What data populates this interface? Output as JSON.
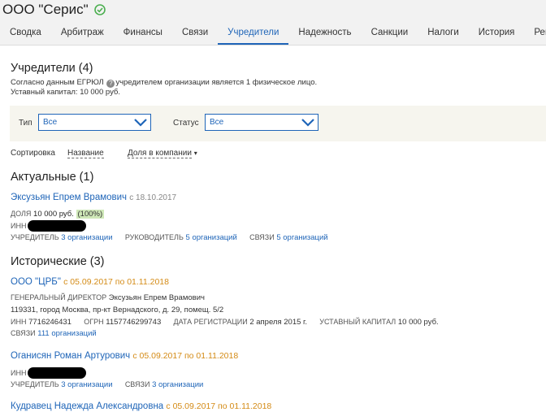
{
  "header": {
    "company_name": "ООО \"Серис\"",
    "tabs": [
      "Сводка",
      "Арбитраж",
      "Финансы",
      "Связи",
      "Учредители",
      "Надежность",
      "Санкции",
      "Налоги",
      "История",
      "Рек"
    ],
    "active_tab": "Учредители"
  },
  "colors": {
    "accent": "#1f65b8",
    "orange": "#d48b16",
    "filter_bg": "#f6f5ee",
    "badge_bg": "#cfe8b8"
  },
  "section": {
    "title": "Учредители (4)",
    "desc_before": "Согласно данным ЕГРЮЛ",
    "desc_after": "учредителем организации является 1 физическое лицо.",
    "capital": "Уставный капитал: 10 000 руб."
  },
  "filters": {
    "type_label": "Тип",
    "type_value": "Все",
    "status_label": "Статус",
    "status_value": "Все"
  },
  "sort": {
    "label": "Сортировка",
    "by_name": "Название",
    "by_share": "Доля в компании",
    "arrow": "▾"
  },
  "current": {
    "title": "Актуальные (1)",
    "items": [
      {
        "name": "Эксузьян Епрем Врамович",
        "since": "с 18.10.2017",
        "share_label": "ДОЛЯ",
        "share_value": "10 000 руб.",
        "share_percent": "(100%)",
        "inn_label": "ИНН",
        "founder_label": "УЧРЕДИТЕЛЬ",
        "founder_link": "3 организации",
        "head_label": "РУКОВОДИТЕЛЬ",
        "head_link": "5 организаций",
        "links_label": "СВЯЗИ",
        "links_link": "5 организаций"
      }
    ]
  },
  "historical": {
    "title": "Исторические (3)",
    "items": [
      {
        "name": "ООО \"ЦРБ\"",
        "period": "с 05.09.2017 по 01.11.2018",
        "director_label": "ГЕНЕРАЛЬНЫЙ ДИРЕКТОР",
        "director_name": "Эксузьян Епрем Врамович",
        "address": "119331, город Москва, пр-кт Вернадского, д. 29, помещ. 5/2",
        "inn_label": "ИНН",
        "inn_value": "7716246431",
        "ogrn_label": "ОГРН",
        "ogrn_value": "1157746299743",
        "reg_label": "ДАТА РЕГИСТРАЦИИ",
        "reg_value": "2 апреля 2015 г.",
        "capital_label": "УСТАВНЫЙ КАПИТАЛ",
        "capital_value": "10 000 руб.",
        "links_label": "СВЯЗИ",
        "links_link": "111 организаций"
      },
      {
        "name": "Оганисян Роман Артурович",
        "period": "с 05.09.2017 по 01.11.2018",
        "inn_label": "ИНН",
        "founder_label": "УЧРЕДИТЕЛЬ",
        "founder_link": "3 организации",
        "links_label": "СВЯЗИ",
        "links_link": "3 организации"
      },
      {
        "name": "Кудравец Надежда Александровна",
        "period": "с 05.09.2017 по 01.11.2018"
      }
    ]
  }
}
